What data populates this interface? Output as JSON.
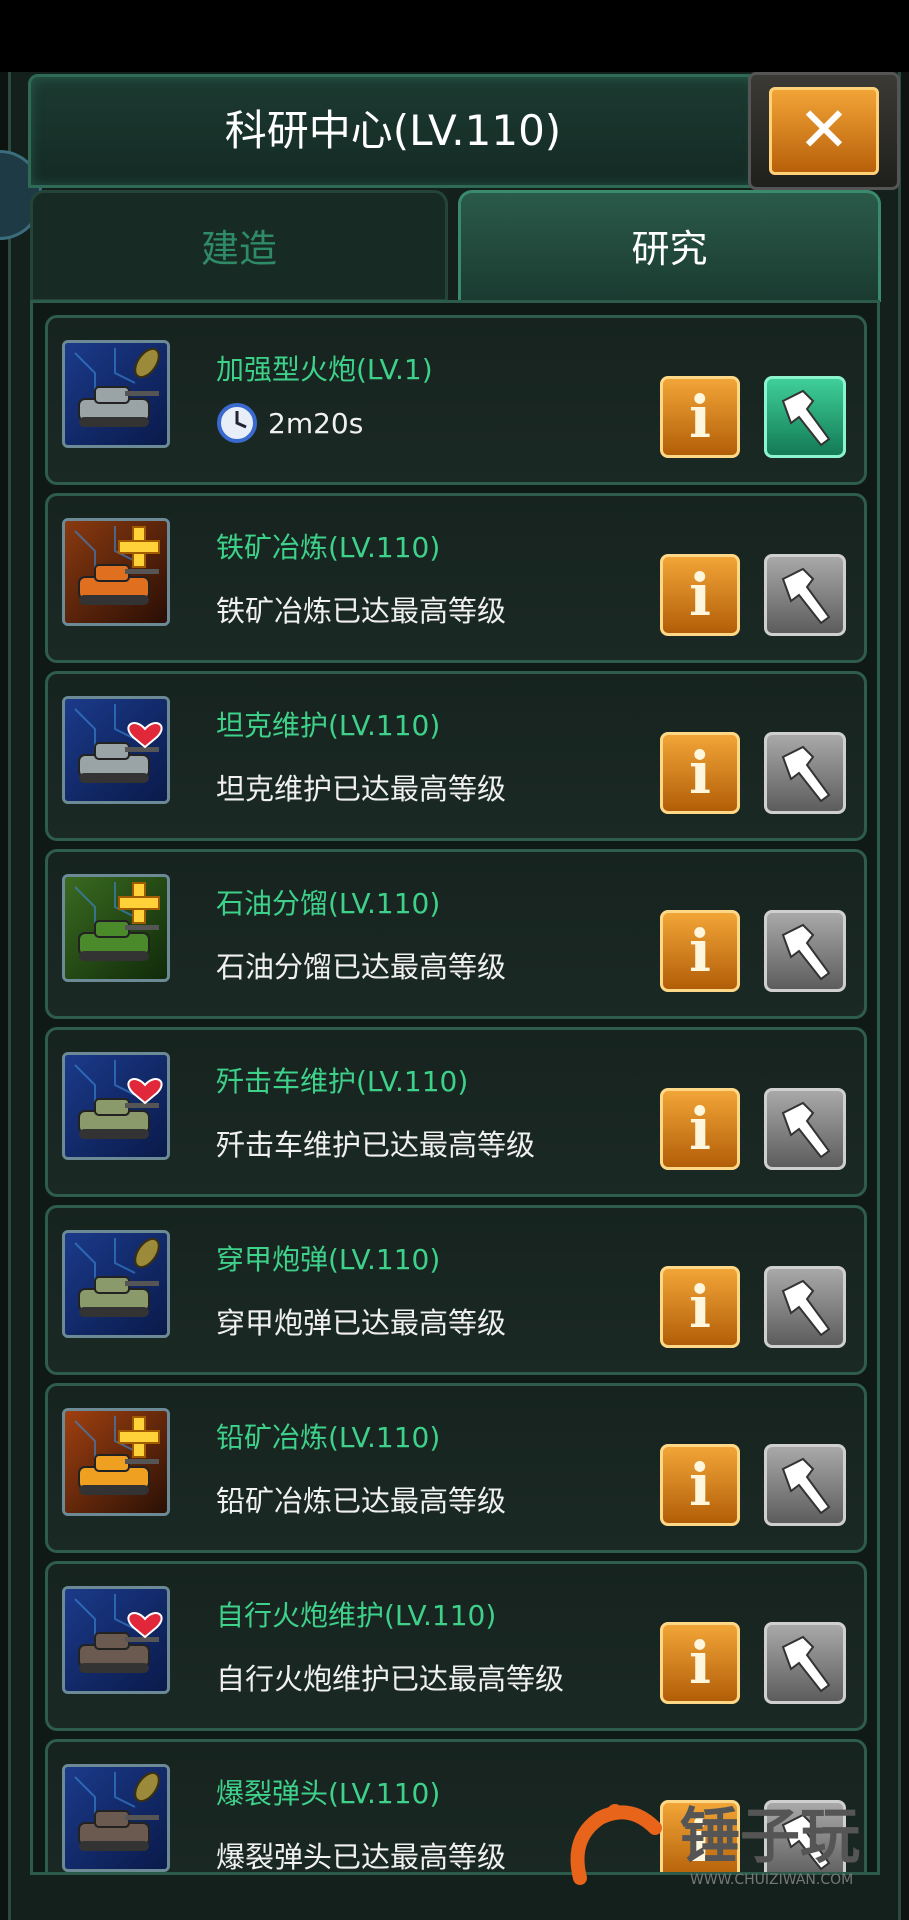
{
  "window": {
    "title": "科研中心(LV.110)",
    "close_label": "✕"
  },
  "tabs": [
    {
      "label": "建造",
      "active": false
    },
    {
      "label": "研究",
      "active": true
    }
  ],
  "research_items": [
    {
      "name": "加强型火炮(LV.1)",
      "status": "2m20s",
      "icon": "tank-shell-icon",
      "in_progress": true
    },
    {
      "name": "铁矿冶炼(LV.110)",
      "status": "铁矿冶炼已达最高等级",
      "icon": "iron-smelting-icon",
      "in_progress": false
    },
    {
      "name": "坦克维护(LV.110)",
      "status": "坦克维护已达最高等级",
      "icon": "tank-heart-icon",
      "in_progress": false
    },
    {
      "name": "石油分馏(LV.110)",
      "status": "石油分馏已达最高等级",
      "icon": "oil-barrel-icon",
      "in_progress": false
    },
    {
      "name": "歼击车维护(LV.110)",
      "status": "歼击车维护已达最高等级",
      "icon": "destroyer-heart-icon",
      "in_progress": false
    },
    {
      "name": "穿甲炮弹(LV.110)",
      "status": "穿甲炮弹已达最高等级",
      "icon": "destroyer-shell-icon",
      "in_progress": false
    },
    {
      "name": "铅矿冶炼(LV.110)",
      "status": "铅矿冶炼已达最高等级",
      "icon": "lead-smelting-icon",
      "in_progress": false
    },
    {
      "name": "自行火炮维护(LV.110)",
      "status": "自行火炮维护已达最高等级",
      "icon": "artillery-heart-icon",
      "in_progress": false
    },
    {
      "name": "爆裂弹头(LV.110)",
      "status": "爆裂弹头已达最高等级",
      "icon": "artillery-shell-icon",
      "in_progress": false
    }
  ],
  "buttons": {
    "info_label": "i"
  },
  "watermark": {
    "brand": "锤子玩",
    "url": "WWW.CHUIZIWAN.COM"
  },
  "colors": {
    "name_green": "#3ed18a",
    "info_orange": "#f2a537",
    "active_hammer_green": "#3fcf9a",
    "disabled_hammer_gray": "#8a8a8a"
  }
}
